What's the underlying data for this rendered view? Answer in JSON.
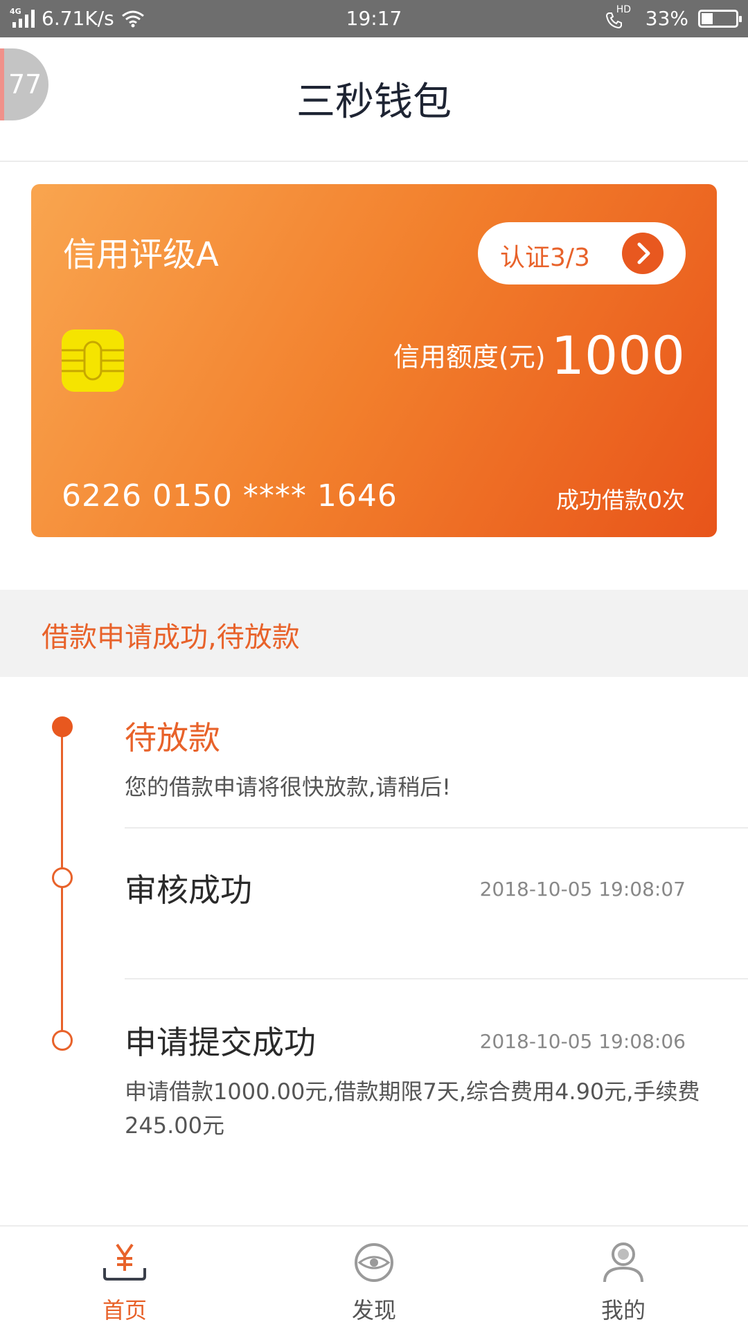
{
  "status_bar": {
    "network": "4G",
    "speed": "6.71K/s",
    "time": "19:17",
    "hd": "HD",
    "battery": "33%",
    "battery_level": 0.33
  },
  "header": {
    "badge": "77",
    "title": "三秒钱包"
  },
  "card": {
    "rating": "信用评级A",
    "auth_label": "认证3/3",
    "limit_label": "信用额度(元)",
    "limit_value": "1000",
    "card_number": "6226 0150 **** 1646",
    "success_loans": "成功借款0次"
  },
  "banner": {
    "text": "借款申请成功,待放款"
  },
  "timeline": [
    {
      "title": "待放款",
      "desc": "您的借款申请将很快放款,请稍后!",
      "time": ""
    },
    {
      "title": "审核成功",
      "desc": "",
      "time": "2018-10-05  19:08:07"
    },
    {
      "title": "申请提交成功",
      "desc": "申请借款1000.00元,借款期限7天,综合费用4.90元,手续费245.00元",
      "time": "2018-10-05  19:08:06"
    }
  ],
  "bottom_nav": [
    {
      "label": "首页",
      "icon": "yuan-icon",
      "active": true
    },
    {
      "label": "发现",
      "icon": "eye-icon",
      "active": false
    },
    {
      "label": "我的",
      "icon": "person-icon",
      "active": false
    }
  ],
  "colors": {
    "accent": "#e8622a",
    "card_start": "#f9a54f",
    "card_end": "#e8541a",
    "chip": "#f5e400"
  }
}
